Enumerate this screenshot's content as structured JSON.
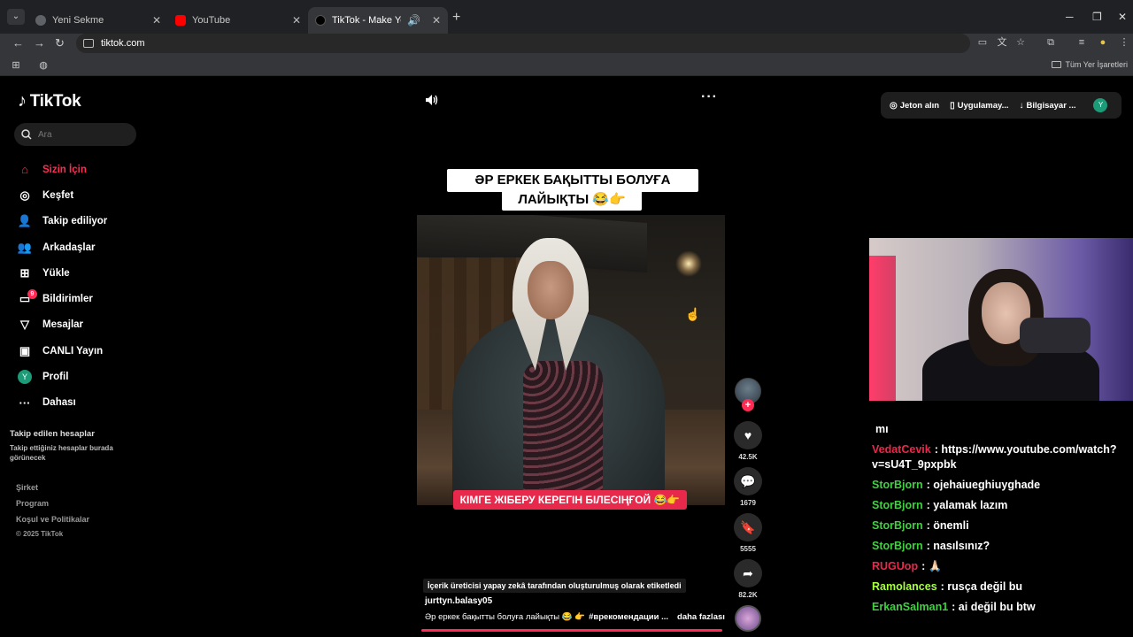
{
  "browser": {
    "tabs": [
      {
        "title": "Yeni Sekme",
        "icon": "chrome-icon",
        "color": "#5f6368"
      },
      {
        "title": "YouTube",
        "icon": "youtube-icon",
        "color": "#ff0000"
      },
      {
        "title": "TikTok - Make Your Day",
        "icon": "tiktok-icon",
        "color": "#000000"
      }
    ],
    "url": "tiktok.com",
    "bookmarks_label": "Tüm Yer İşaretleri"
  },
  "sidebar": {
    "logo": "TikTok",
    "search_placeholder": "Ara",
    "items": [
      {
        "label": "Sizin İçin",
        "icon": "home-icon"
      },
      {
        "label": "Keşfet",
        "icon": "compass-icon"
      },
      {
        "label": "Takip ediliyor",
        "icon": "following-icon"
      },
      {
        "label": "Arkadaşlar",
        "icon": "friends-icon"
      },
      {
        "label": "Yükle",
        "icon": "upload-icon"
      },
      {
        "label": "Bildirimler",
        "icon": "inbox-icon",
        "badge": "9"
      },
      {
        "label": "Mesajlar",
        "icon": "send-icon"
      },
      {
        "label": "CANLI Yayın",
        "icon": "live-icon"
      },
      {
        "label": "Profil",
        "icon": "profile-avatar",
        "avatar_letter": "Y"
      },
      {
        "label": "Dahası",
        "icon": "more-icon"
      }
    ],
    "following_title": "Takip edilen hesaplar",
    "following_sub": "Takip ettiğiniz hesaplar burada görünecek",
    "footer": [
      "Şirket",
      "Program",
      "Koşul ve Politikalar"
    ],
    "copyright": "© 2025 TikTok"
  },
  "header": {
    "coins": "Jeton alın",
    "app": "Uygulamay...",
    "desktop": "Bilgisayar ...",
    "avatar_letter": "Y"
  },
  "video": {
    "caption_line1": "ӘР ЕРКЕК БАҚЫТТЫ БОЛУҒА",
    "caption_line2": "ЛАЙЫҚТЫ 😂👉",
    "subtitle": "КІМГЕ ЖІБЕРУ КЕРЕГІН БІЛЕСІҢҒОЙ 😂👉",
    "ai_label": "İçerik üreticisi yapay zekâ tarafından oluşturulmuş olarak etiketledi",
    "username": "jurttyn.balasy05",
    "description": "Әр еркек бақытты болуға лайықты 😂 👉",
    "hashtag": "#врекомендации ...",
    "more": "daha fazlası",
    "likes": "42.5K",
    "comments": "1679",
    "saves": "5555",
    "shares": "82.2K"
  },
  "chat": [
    {
      "user": "",
      "text": "mı",
      "color": "#ffffff"
    },
    {
      "user": "VedatCevik",
      "text": ": https://www.youtube.com/watch?v=sU4T_9pxpbk",
      "color": "#e8294b"
    },
    {
      "user": "StorBjorn",
      "text": ": ojehaiueghiuyghade",
      "color": "#3fd13f"
    },
    {
      "user": "StorBjorn",
      "text": ": yalamak lazım",
      "color": "#3fd13f"
    },
    {
      "user": "StorBjorn",
      "text": ": önemli",
      "color": "#3fd13f"
    },
    {
      "user": "StorBjorn",
      "text": ": nasılsınız?",
      "color": "#3fd13f"
    },
    {
      "user": "RUGUop",
      "text": ": 🙏🏻",
      "color": "#e8294b"
    },
    {
      "user": "Ramolances",
      "text": ": rusça değil bu",
      "color": "#a7ff3f"
    },
    {
      "user": "ErkanSalman1",
      "text": ": ai değil bu btw",
      "color": "#3fd13f"
    }
  ]
}
